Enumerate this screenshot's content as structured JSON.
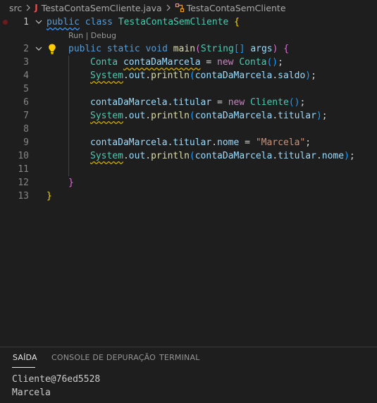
{
  "breadcrumb": {
    "folder": "src",
    "file": "TestaContaSemCliente.java",
    "file_icon": "J",
    "symbol": "TestaContaSemCliente"
  },
  "editor": {
    "line_numbers": [
      "1",
      "2",
      "3",
      "4",
      "5",
      "6",
      "7",
      "8",
      "9",
      "10",
      "11",
      "12",
      "13"
    ],
    "codelens": {
      "run": "Run",
      "sep": " | ",
      "debug": "Debug"
    },
    "tokens": {
      "l1_public": "public",
      "l1_class": "class",
      "l1_name": "TestaContaSemCliente",
      "l1_brace": "{",
      "l2_public": "public",
      "l2_static": "static",
      "l2_void": "void",
      "l2_main": "main",
      "l2_paren_open": "(",
      "l2_string": "String",
      "l2_arr": "[]",
      "l2_args": "args",
      "l2_paren_close": ")",
      "l2_brace": "{",
      "l3_type": "Conta",
      "l3_var": "contaDaMarcela",
      "l3_eq": " = ",
      "l3_new": "new",
      "l3_ctor": "Conta",
      "l3_parens": "()",
      "l3_semi": ";",
      "l4_system": "System",
      "l4_out": "out",
      "l4_println": "println",
      "l4_obj": "contaDaMarcela",
      "l4_field": "saldo",
      "l6_obj": "contaDaMarcela",
      "l6_field": "titular",
      "l6_eq": " = ",
      "l6_new": "new",
      "l6_ctor": "Cliente",
      "l6_parens": "()",
      "l6_semi": ";",
      "l7_system": "System",
      "l7_out": "out",
      "l7_println": "println",
      "l7_obj": "contaDaMarcela",
      "l7_field": "titular",
      "l9_obj": "contaDaMarcela",
      "l9_field": "titular",
      "l9_field2": "nome",
      "l9_eq": " = ",
      "l9_str": "\"Marcela\"",
      "l9_semi": ";",
      "l10_system": "System",
      "l10_out": "out",
      "l10_println": "println",
      "l10_obj": "contaDaMarcela",
      "l10_field": "titular",
      "l10_field2": "nome",
      "l12_brace": "}",
      "l13_brace": "}"
    }
  },
  "panel": {
    "tabs": [
      "SAÍDA",
      "CONSOLE DE DEPURAÇÃO",
      "TERMINAL"
    ],
    "active_tab": "SAÍDA",
    "output": [
      "Cliente@76ed5528",
      "Marcela"
    ]
  },
  "colors": {
    "background": "#1e1e1e",
    "keyword": "#569cd6",
    "control_keyword": "#c586c0",
    "type": "#4ec9b0",
    "variable": "#9cdcfe",
    "function": "#dcdcaa",
    "string": "#ce9178",
    "bracket_1": "#ffd700",
    "bracket_2": "#da70d6",
    "bracket_3": "#179fff",
    "file_icon": "#f14c4c"
  }
}
